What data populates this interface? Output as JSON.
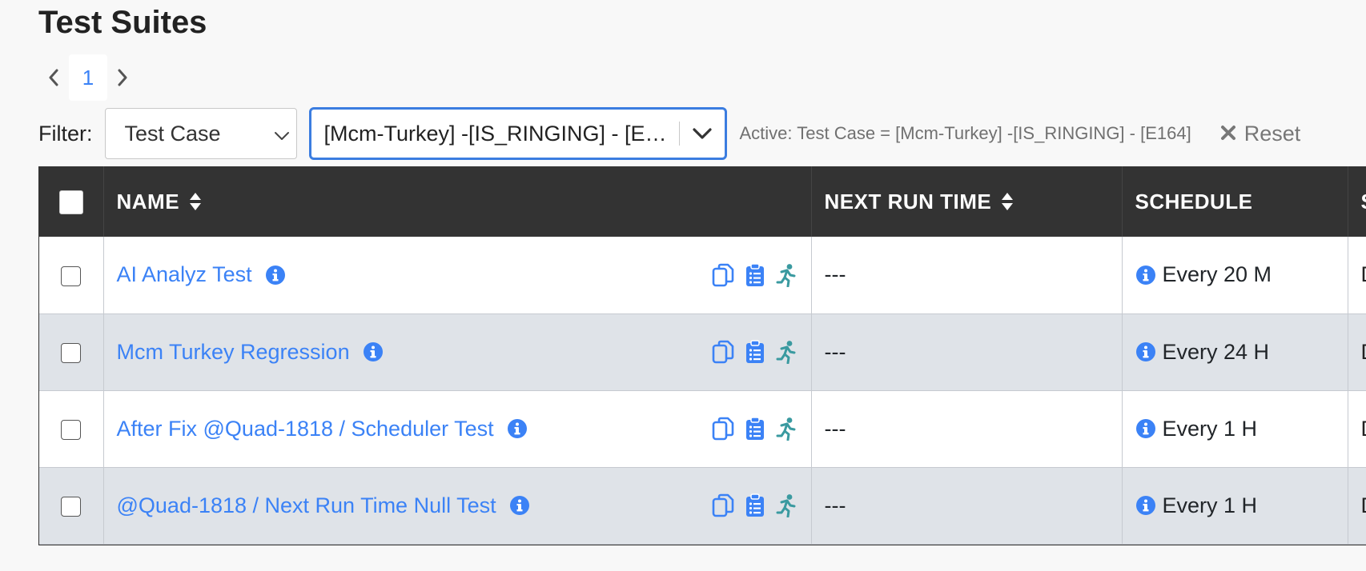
{
  "page": {
    "title": "Test Suites"
  },
  "pagination": {
    "current_page": "1"
  },
  "filter": {
    "label": "Filter:",
    "field_value": "Test Case",
    "value_display": "[Mcm-Turkey] -[IS_RINGING] - [E164]",
    "active_text": "Active: Test Case = [Mcm-Turkey] -[IS_RINGING] - [E164]",
    "reset_label": "Reset"
  },
  "table": {
    "headers": {
      "name": "NAME",
      "next_run_time": "NEXT RUN TIME",
      "schedule": "SCHEDULE",
      "extra": "S"
    },
    "rows": [
      {
        "name": "AI Analyz Test",
        "next_run_time": "---",
        "schedule": "Every 20 M",
        "extra": "D"
      },
      {
        "name": "Mcm Turkey Regression",
        "next_run_time": "---",
        "schedule": "Every 24 H",
        "extra": "D"
      },
      {
        "name": "After Fix @Quad-1818 / Scheduler Test",
        "next_run_time": "---",
        "schedule": "Every 1 H",
        "extra": "D"
      },
      {
        "name": "@Quad-1818 / Next Run Time Null Test",
        "next_run_time": "---",
        "schedule": "Every 1 H",
        "extra": "D"
      }
    ]
  },
  "colors": {
    "accent": "#3b82f6",
    "header_bg": "#333333",
    "run_icon": "#3a9aa0",
    "row_alt": "#dfe3e8"
  },
  "icons": [
    "chevron-left-icon",
    "chevron-right-icon",
    "chevron-down-icon",
    "close-icon",
    "sort-icon",
    "info-icon",
    "copy-icon",
    "clipboard-list-icon",
    "run-icon"
  ]
}
